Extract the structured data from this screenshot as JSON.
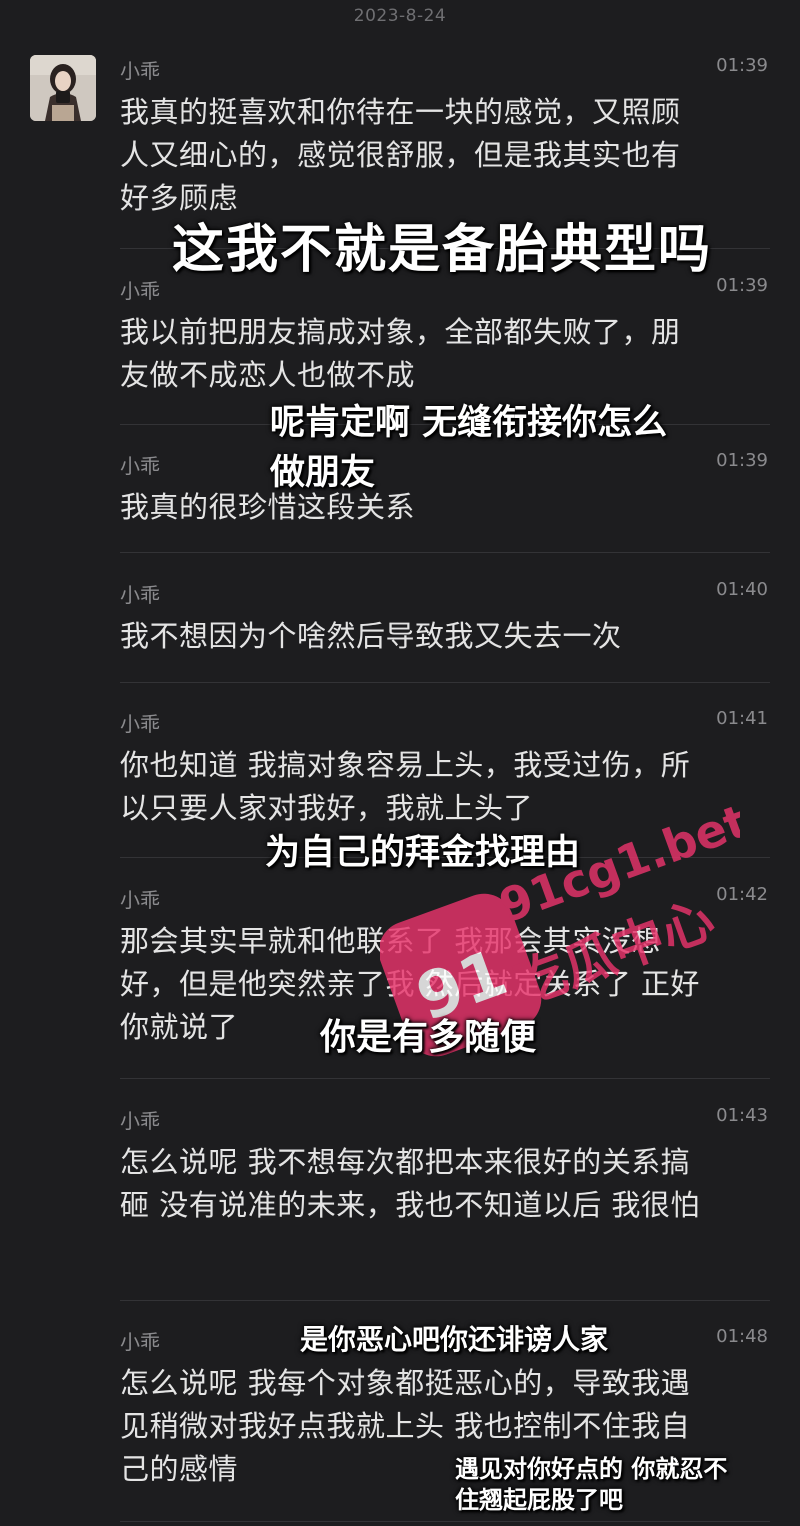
{
  "date": "2023-8-24",
  "contact": {
    "name": "小乖"
  },
  "messages": [
    {
      "name": "小乖",
      "time": "01:39",
      "text": "我真的挺喜欢和你待在一块的感觉，又照顾\n人又细心的，感觉很舒服，但是我其实也有\n好多顾虑"
    },
    {
      "name": "小乖",
      "time": "01:39",
      "text": "我以前把朋友搞成对象，全部都失败了，朋\n友做不成恋人也做不成"
    },
    {
      "name": "小乖",
      "time": "01:39",
      "text": "我真的很珍惜这段关系"
    },
    {
      "name": "小乖",
      "time": "01:40",
      "text": "我不想因为个啥然后导致我又失去一次"
    },
    {
      "name": "小乖",
      "time": "01:41",
      "text": "你也知道 我搞对象容易上头，我受过伤，所\n以只要人家对我好，我就上头了"
    },
    {
      "name": "小乖",
      "time": "01:42",
      "text": "那会其实早就和他联系了 我那会其实没想\n好，但是他突然亲了我 然后就定关系了 正好\n你就说了"
    },
    {
      "name": "小乖",
      "time": "01:43",
      "text": "怎么说呢  我不想每次都把本来很好的关系搞\n砸 没有说准的未来，我也不知道以后 我很怕"
    },
    {
      "name": "小乖",
      "time": "01:48",
      "text": "怎么说呢  我每个对象都挺恶心的，导致我遇\n见稍微对我好点我就上头 我也控制不住我自\n己的感情"
    }
  ],
  "overlays": [
    "这我不就是备胎典型吗",
    "呢肯定啊 无缝衔接你怎么\n做朋友",
    "为自己的拜金找理由",
    "你是有多随便",
    "是你恶心吧你还诽谤人家",
    "遇见对你好点的 你就忍不\n住翘起屁股了吧"
  ],
  "watermark": {
    "line1": "91cg1.bet",
    "line2": "吃瓜中心",
    "badge": "91",
    "color": "#e8336b"
  }
}
